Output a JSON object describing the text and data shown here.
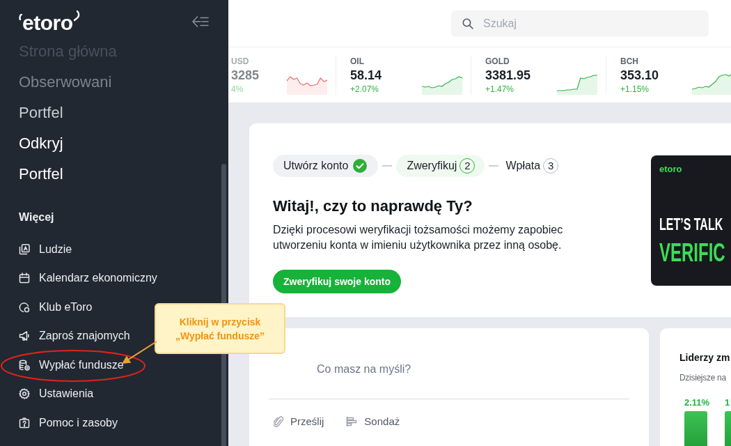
{
  "sidebar": {
    "logo": "etoro",
    "nav_items": [
      {
        "label": "Strona główna"
      },
      {
        "label": "Obserwowani"
      },
      {
        "label": "Portfel"
      },
      {
        "label": "Odkryj"
      },
      {
        "label": "Portfel"
      }
    ],
    "section_title": "Więcej",
    "more_items": [
      {
        "label": "Ludzie",
        "circled": false
      },
      {
        "label": "Kalendarz ekonomiczny",
        "circled": false
      },
      {
        "label": "Klub eToro",
        "circled": false
      },
      {
        "label": "Zaproś znajomych",
        "circled": false
      },
      {
        "label": "Wypłać fundusze",
        "circled": true
      },
      {
        "label": "Ustawienia",
        "circled": false
      },
      {
        "label": "Pomoc i zasoby",
        "circled": false
      }
    ]
  },
  "search": {
    "placeholder": "Szukaj"
  },
  "ticker": [
    {
      "symbol": "USD",
      "price": "3285",
      "change": "4%",
      "rising": false
    },
    {
      "symbol": "OIL",
      "price": "58.14",
      "change": "+2.07%",
      "rising": true
    },
    {
      "symbol": "GOLD",
      "price": "3381.95",
      "change": "+1.47%",
      "rising": true
    },
    {
      "symbol": "BCH",
      "price": "353.10",
      "change": "+1.15%",
      "rising": true
    }
  ],
  "verification_card": {
    "steps": [
      {
        "label": "Utwórz konto",
        "completed": true,
        "current": false
      },
      {
        "label": "Zweryfikuj",
        "number": "2",
        "completed": false,
        "current": true
      },
      {
        "label": "Wpłata",
        "number": "3",
        "completed": false,
        "current": false
      }
    ],
    "heading": "Witaj!, czy to naprawdę Ty?",
    "description": "Dzięki procesowi weryfikacji tożsamości możemy zapobiec utworzeniu konta w imieniu użytkownika przez inną osobę.",
    "button": "Zweryfikuj swoje konto",
    "banner": {
      "logo": "etoro",
      "line_1": "LET’S TALK",
      "line_2": "VERIFIC"
    }
  },
  "composer": {
    "placeholder": "Co masz na myśli?",
    "actions": [
      "Prześlij",
      "Sondaż"
    ]
  },
  "movers": {
    "title": "Liderzy zm",
    "subtitle": "Dzisiejsze na",
    "bars": [
      {
        "value": "2.11%"
      },
      {
        "value": "1"
      }
    ]
  },
  "callout": {
    "text": "Kliknij w przycisk „Wypłać fundusze”"
  }
}
